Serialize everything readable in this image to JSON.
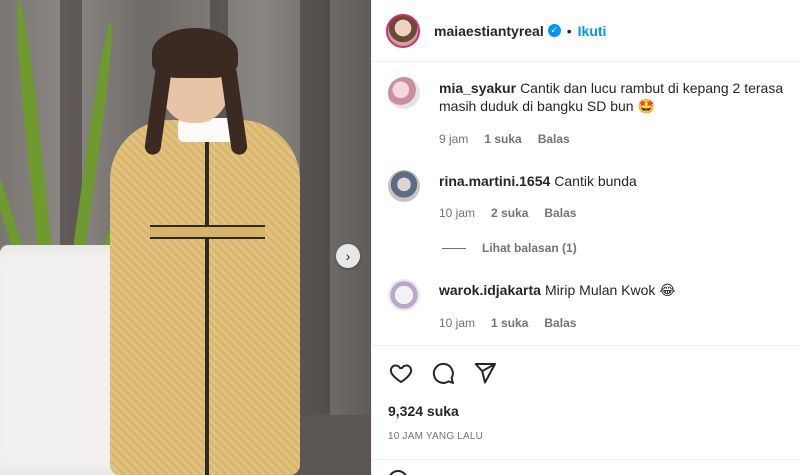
{
  "post": {
    "username": "maiaestiantyreal",
    "verified_icon": "verified-badge-icon",
    "separator": "•",
    "follow_label": "Ikuti"
  },
  "comments": [
    {
      "username": "mia_syakur",
      "text": "Cantik dan lucu rambut di kepang 2 terasa masih duduk di bangku SD bun 🤩",
      "time": "9 jam",
      "likes": "1 suka",
      "reply_label": "Balas"
    },
    {
      "username": "rina.martini.1654",
      "text": "Cantik bunda",
      "time": "10 jam",
      "likes": "2 suka",
      "reply_label": "Balas",
      "view_replies": "Lihat balasan (1)"
    },
    {
      "username": "warok.idjakarta",
      "text": "Mirip Mulan Kwok 😂",
      "time": "10 jam",
      "likes": "1 suka",
      "reply_label": "Balas"
    }
  ],
  "actions": {
    "like_icon": "heart-icon",
    "comment_icon": "comment-icon",
    "share_icon": "send-icon",
    "likes_count": "9,324 suka",
    "time_ago": "10 JAM YANG LALU"
  },
  "colors": {
    "accent": "#0095f6",
    "text": "#262626",
    "muted": "#737373",
    "divider": "#efefef"
  }
}
